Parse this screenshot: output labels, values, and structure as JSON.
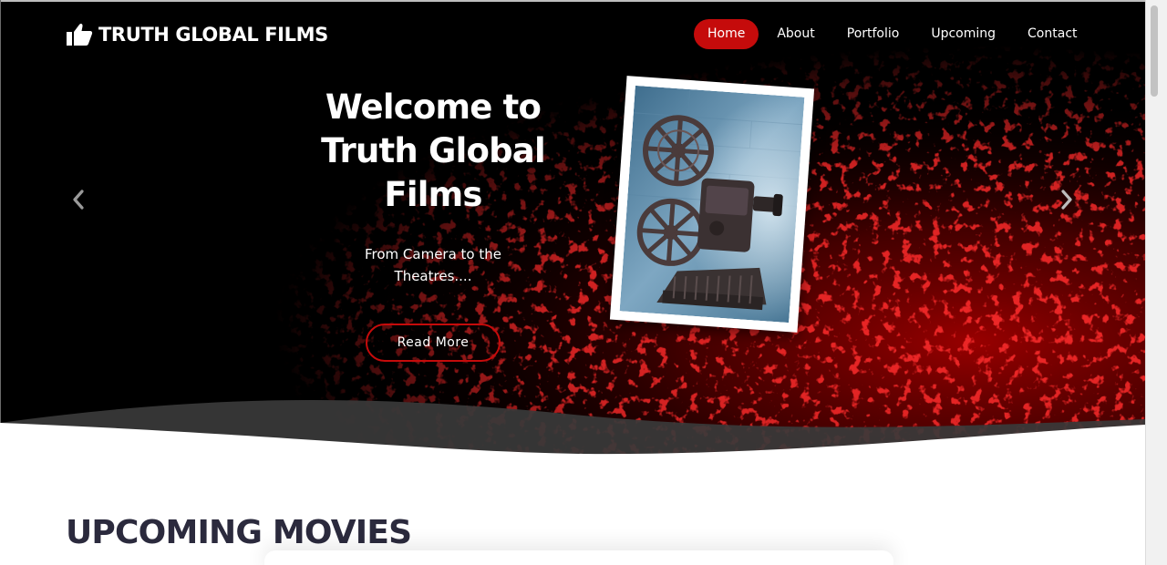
{
  "brand": {
    "logo_icon": "thumbs-up-icon",
    "name": "TRUTH GLOBAL FILMS"
  },
  "nav": {
    "items": [
      {
        "label": "Home",
        "active": true
      },
      {
        "label": "About",
        "active": false
      },
      {
        "label": "Portfolio",
        "active": false
      },
      {
        "label": "Upcoming",
        "active": false
      },
      {
        "label": "Contact",
        "active": false
      }
    ]
  },
  "hero": {
    "title": "Welcome to Truth Global Films",
    "subtitle": "From Camera to the Theatres....",
    "cta_label": "Read More",
    "prev_icon": "chevron-left-icon",
    "next_icon": "chevron-right-icon"
  },
  "sections": {
    "upcoming_title": "UPCOMING MOVIES"
  },
  "colors": {
    "accent": "#c50b0b",
    "hero_background": "#000000",
    "heading_dark": "#2b2a3d"
  }
}
